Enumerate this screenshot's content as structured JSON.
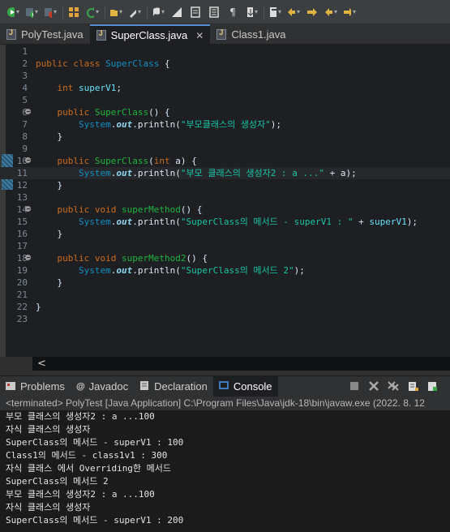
{
  "toolbar": {
    "icons": [
      "debug-icon",
      "run-icon",
      "coverage-icon",
      "new-java-package-icon",
      "refresh-icon",
      "open-folder-icon",
      "brush-icon",
      "search-icon",
      "comment-icon",
      "edit-icon",
      "format-icon",
      "paragraph-icon",
      "move-icon",
      "annotation-icon",
      "back-icon",
      "forward-icon",
      "previous-icon",
      "next-icon"
    ]
  },
  "tabs": [
    {
      "label": "PolyTest.java",
      "active": false
    },
    {
      "label": "SuperClass.java",
      "active": true,
      "close": "✕"
    },
    {
      "label": "Class1.java",
      "active": false
    }
  ],
  "editor": {
    "line_numbers": [
      "1",
      "2",
      "3",
      "4",
      "5",
      "6",
      "7",
      "8",
      "9",
      "10",
      "11",
      "12",
      "13",
      "14",
      "15",
      "16",
      "17",
      "18",
      "19",
      "20",
      "21",
      "22",
      "23"
    ],
    "code": {
      "l2": {
        "kw1": "public",
        "kw2": "class",
        "name": "SuperClass",
        "rest": " {"
      },
      "l4": {
        "kw": "int",
        "field": "superV1",
        "rest": ";"
      },
      "l6": {
        "kw": "public",
        "name": "SuperClass",
        "rest": "() {"
      },
      "l7": {
        "sys": "System",
        "dot1": ".",
        "out": "out",
        "dot2": ".",
        "m": "println",
        "open": "(",
        "str": "\"부모클래스의 생성자\"",
        "close": ");"
      },
      "l8": {
        "rest": "}"
      },
      "l10": {
        "kw": "public",
        "name": "SuperClass",
        "open": "(",
        "kw2": "int",
        "param": "a",
        "close": ") {"
      },
      "l11": {
        "sys": "System",
        "dot1": ".",
        "out": "out",
        "dot2": ".",
        "m": "println",
        "open": "(",
        "str": "\"부모 클래스의 생성자2 : a ...\"",
        "plus": " + ",
        "param": "a",
        "close": ");"
      },
      "l12": {
        "rest": "}"
      },
      "l14": {
        "kw": "public",
        "kw2": "void",
        "name": "superMethod",
        "rest": "() {"
      },
      "l15": {
        "sys": "System",
        "dot1": ".",
        "out": "out",
        "dot2": ".",
        "m": "println",
        "open": "(",
        "str": "\"SuperClass의 메서드 - superV1 : \"",
        "plus": " + ",
        "field": "superV1",
        "close": ");"
      },
      "l16": {
        "rest": "}"
      },
      "l18": {
        "kw": "public",
        "kw2": "void",
        "name": "superMethod2",
        "rest": "() {"
      },
      "l19": {
        "sys": "System",
        "dot1": ".",
        "out": "out",
        "dot2": ".",
        "m": "println",
        "open": "(",
        "str": "\"SuperClass의 메서드 2\"",
        "close": ");"
      },
      "l20": {
        "rest": "}"
      },
      "l22": {
        "rest": "}"
      }
    }
  },
  "panel": {
    "tabs": [
      {
        "label": "Problems",
        "icon": "problems-icon"
      },
      {
        "label": "Javadoc",
        "icon": "javadoc-icon"
      },
      {
        "label": "Declaration",
        "icon": "declaration-icon"
      },
      {
        "label": "Console",
        "icon": "console-icon",
        "active": true
      }
    ],
    "status": "<terminated> PolyTest [Java Application] C:\\Program Files\\Java\\jdk-18\\bin\\javaw.exe  (2022. 8. 12",
    "console_lines": [
      "부모 클래스의 생성자2 : a ...100",
      "자식 클래스의 생성자",
      "SuperClass의 메서드 - superV1 : 100",
      "Class1의 메서드 - class1v1 : 300",
      "자식 클래스 에서 Overriding한 메서드",
      "SuperClass의 메서드 2",
      "부모 클래스의 생성자2 : a ...100",
      "자식 클래스의 생성자",
      "SuperClass의 메서드 - superV1 : 200"
    ]
  }
}
